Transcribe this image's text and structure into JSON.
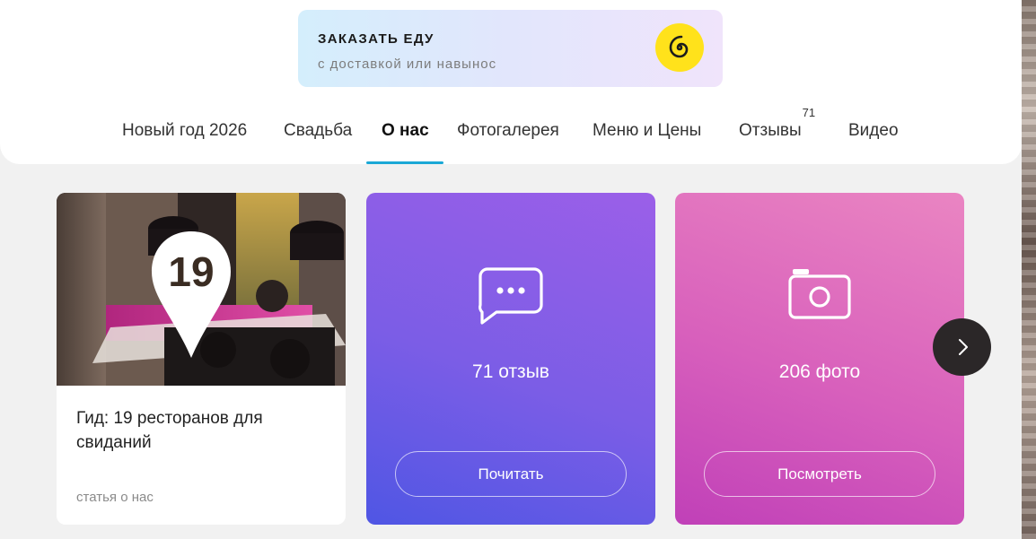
{
  "order_banner": {
    "title": "ЗАКАЗАТЬ ЕДУ",
    "subtitle": "с доставкой или навынос",
    "logo_icon": "spiral-icon",
    "logo_color": "#ffe21b"
  },
  "tabs": [
    {
      "label": "Новый год 2026"
    },
    {
      "label": "Свадьба"
    },
    {
      "label": "О нас",
      "active": true
    },
    {
      "label": "Фотогалерея"
    },
    {
      "label": "Меню и Цены"
    },
    {
      "label": "Отзывы",
      "badge": "71"
    },
    {
      "label": "Видео"
    }
  ],
  "accent_color": "#1aa8d6",
  "article_card": {
    "pin_number": "19",
    "title": "Гид: 19 ресторанов для свиданий",
    "meta": "статья о нас"
  },
  "reviews_card": {
    "icon": "chat-bubble-icon",
    "count_text": "71 отзыв",
    "button": "Почитать"
  },
  "photos_card": {
    "icon": "camera-icon",
    "count_text": "206 фото",
    "button": "Посмотреть"
  },
  "carousel": {
    "next_icon": "chevron-right-icon"
  }
}
